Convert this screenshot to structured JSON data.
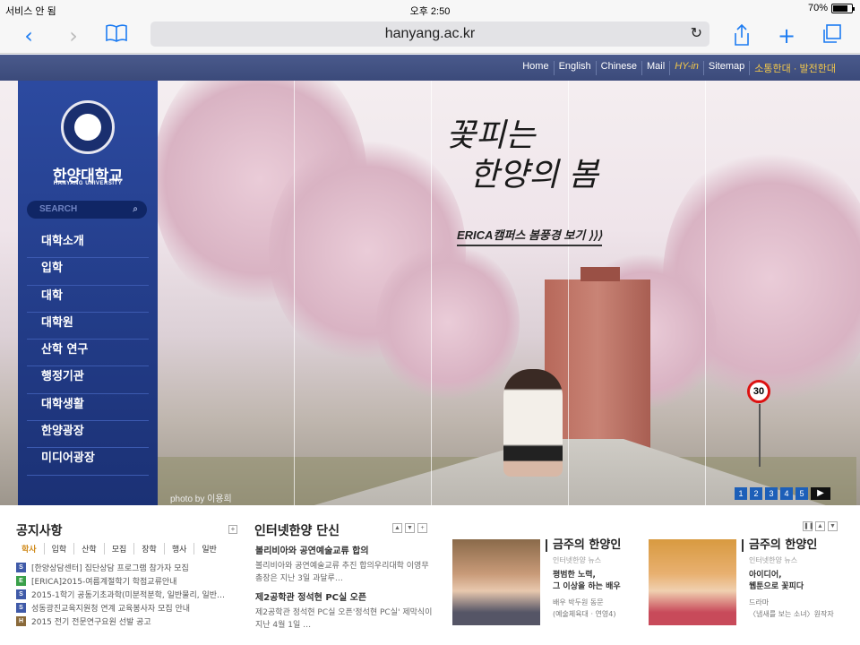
{
  "status": {
    "carrier": "서비스 안 됨",
    "time": "오후 2:50",
    "battery": "70%",
    "battery_level": 0.7
  },
  "browser": {
    "url": "hanyang.ac.kr"
  },
  "topnav": [
    "Home",
    "English",
    "Chinese",
    "Mail",
    "HY-in",
    "Sitemap",
    "소통한대 · 발전한대"
  ],
  "brand": {
    "ko": "한양대학교",
    "en": "HANYANG UNIVERSITY"
  },
  "search": {
    "placeholder": "SEARCH"
  },
  "menu": [
    "대학소개",
    "입학",
    "대학",
    "대학원",
    "산학 연구",
    "행정기관",
    "대학생활",
    "한양광장",
    "미디어광장"
  ],
  "hero": {
    "title_line1": "꽃피는",
    "title_line2": "한양의 봄",
    "link": "ERICA캠퍼스 봄풍경 보기  ⟩⟩⟩",
    "credit": "photo by 이용희",
    "sign": "30",
    "pages": [
      "1",
      "2",
      "3",
      "4",
      "5"
    ]
  },
  "notice": {
    "title": "공지사항",
    "tabs": [
      "학사",
      "입학",
      "산학",
      "모집",
      "장학",
      "행사",
      "일반"
    ],
    "items": [
      {
        "badge": "S",
        "color": "#3f5aa8",
        "text": "[한양상담센터] 집단상담 프로그램 참가자 모집"
      },
      {
        "badge": "E",
        "color": "#3aa04a",
        "text": "[ERICA]2015-여름계절학기 학점교류안내"
      },
      {
        "badge": "S",
        "color": "#3f5aa8",
        "text": "2015-1학기 공동기초과학(미분적분학, 일반물리, 일반…"
      },
      {
        "badge": "S",
        "color": "#3f5aa8",
        "text": "성동광진교육지원청 연계 교육봉사자 모집 안내"
      },
      {
        "badge": "H",
        "color": "#8a6a3a",
        "text": "2015 전기 전문연구요원 선발 공고"
      }
    ]
  },
  "news": {
    "title": "인터넷한양 단신",
    "items": [
      {
        "headline": "볼리비아와 공연예술교류 합의",
        "body": "볼리비아와 공연예술교류 추진 합의우리대학 이영무 총장은 지난 3일 과달루…"
      },
      {
        "headline": "제2공학관 정석현 PC실 오픈",
        "body": "제2공학관 정석현 PC실 오픈'정석현 PC실' 제막식이 지난 4월 1일 …"
      }
    ]
  },
  "people": [
    {
      "title": "금주의 한양인",
      "sub": "인터넷한양 뉴스",
      "line1": "평범한 노력,",
      "line2": "그 이상을 하는 배우",
      "meta1": "배우 박두원 동문",
      "meta2": "(예술체육대 · 연영4)"
    },
    {
      "title": "금주의 한양인",
      "sub": "인터넷한양 뉴스",
      "line1": "아이디어,",
      "line2": "웹툰으로 꽃피다",
      "meta1": "드라마",
      "meta2": "〈냄새를 보는 소녀〉원작자"
    }
  ]
}
